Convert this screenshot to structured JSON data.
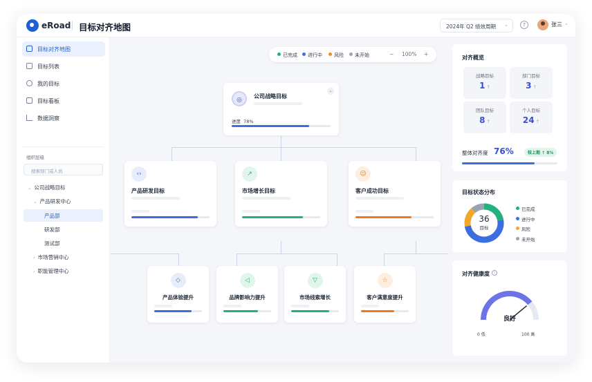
{
  "header": {
    "brand": "eRoad",
    "title": "目标对齐地图",
    "period": "2024年 Q2 绩效周期",
    "help": "?",
    "user": "张三"
  },
  "sidebar": {
    "nav": [
      {
        "label": "目标对齐地图",
        "icon": "map-icon"
      },
      {
        "label": "目标列表",
        "icon": "list-icon"
      },
      {
        "label": "我的目标",
        "icon": "target-icon"
      },
      {
        "label": "目标看板",
        "icon": "kanban-icon"
      },
      {
        "label": "数据洞察",
        "icon": "chart-icon"
      }
    ],
    "org_label": "组织层级",
    "search_placeholder": "搜索部门或人员",
    "tree": [
      {
        "label": "公司战略目标",
        "arrow": "⌄"
      },
      {
        "label": "产品研发中心",
        "arrow": "⌄"
      },
      {
        "label": "产品部",
        "arrow": ""
      },
      {
        "label": "研发部",
        "arrow": ""
      },
      {
        "label": "测试部",
        "arrow": ""
      },
      {
        "label": "市场营销中心",
        "arrow": "›"
      },
      {
        "label": "职能管理中心",
        "arrow": "›"
      }
    ]
  },
  "legend": {
    "items": [
      {
        "label": "已完成",
        "color": "#22b07d"
      },
      {
        "label": "进行中",
        "color": "#3b6fe0"
      },
      {
        "label": "风险",
        "color": "#f08a24"
      },
      {
        "label": "未开始",
        "color": "#9aa3b2"
      }
    ],
    "zoom_out": "−",
    "zoom": "100%",
    "zoom_in": "+"
  },
  "root_card": {
    "title": "公司战略目标",
    "progress_label": "进度",
    "progress_value": "78%",
    "progress": 0.78,
    "color": "#3b6fe0"
  },
  "level1": [
    {
      "title": "产品研发目标",
      "icon": "code-icon",
      "glyph": "‹›",
      "color": "#3b6fe0",
      "bg": "#e6edfb",
      "progress": 0.85
    },
    {
      "title": "市场增长目标",
      "icon": "trend-icon",
      "glyph": "↗",
      "color": "#22b07d",
      "bg": "#e2f5ec",
      "progress": 0.78
    },
    {
      "title": "客户成功目标",
      "icon": "user-icon",
      "glyph": "☺",
      "color": "#f07a1a",
      "bg": "#fdeee0",
      "progress": 0.72
    }
  ],
  "level2": [
    {
      "title": "产品体验提升",
      "icon": "cube-icon",
      "glyph": "◇",
      "color": "#3b6fe0",
      "bg": "#e6edfb",
      "progress": 0.78
    },
    {
      "title": "品牌影响力提升",
      "icon": "megaphone-icon",
      "glyph": "◁",
      "color": "#22b07d",
      "bg": "#e2f5ec",
      "progress": 0.72
    },
    {
      "title": "市场线索增长",
      "icon": "filter-icon",
      "glyph": "▽",
      "color": "#22b07d",
      "bg": "#e2f5ec",
      "progress": 0.8
    },
    {
      "title": "客户满意度提升",
      "icon": "star-icon",
      "glyph": "☆",
      "color": "#f07a1a",
      "bg": "#fdeee0",
      "progress": 0.7
    }
  ],
  "overview": {
    "title": "对齐概览",
    "stats": [
      {
        "label": "战略目标",
        "value": "1",
        "arrow": "↑"
      },
      {
        "label": "部门目标",
        "value": "3",
        "arrow": "↑"
      },
      {
        "label": "团队目标",
        "value": "8",
        "arrow": "↑"
      },
      {
        "label": "个人目标",
        "value": "24",
        "arrow": "↑"
      }
    ],
    "alignment_label": "整体对齐度",
    "alignment_value": "76%",
    "alignment": 0.76,
    "badge": "较上期 ↑ 8%"
  },
  "distribution": {
    "title": "目标状态分布",
    "total": "36",
    "total_label": "目标",
    "items": [
      {
        "label": "已完成",
        "value": 8,
        "color": "#22b07d"
      },
      {
        "label": "进行中",
        "value": 18,
        "color": "#3b6fe0"
      },
      {
        "label": "风险",
        "value": 6,
        "color": "#f0a92a"
      },
      {
        "label": "未开始",
        "value": 4,
        "color": "#9aa3b2"
      }
    ]
  },
  "health": {
    "title": "对齐健康度",
    "status": "良好",
    "min_label": "0 低",
    "max_label": "100 高",
    "value": 0.78
  }
}
